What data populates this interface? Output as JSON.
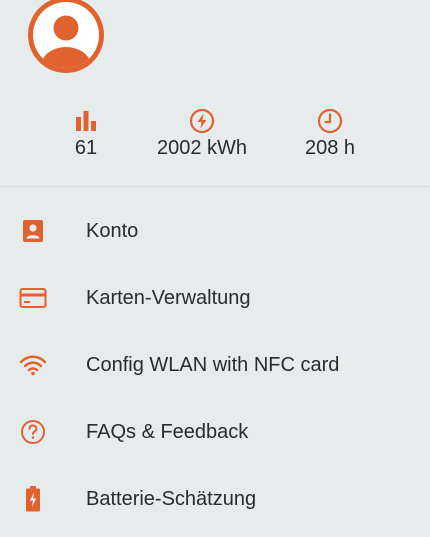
{
  "colors": {
    "accent": "#e0622f",
    "background": "#e6ebec",
    "text": "#2b2b2b"
  },
  "profile": {
    "avatar_icon": "user-circle-icon"
  },
  "stats": [
    {
      "icon": "bar-chart-icon",
      "value": "61"
    },
    {
      "icon": "lightning-icon",
      "value": "2002 kWh"
    },
    {
      "icon": "clock-icon",
      "value": "208 h"
    }
  ],
  "menu": {
    "items": [
      {
        "icon": "account-icon",
        "label": "Konto"
      },
      {
        "icon": "credit-card-icon",
        "label": "Karten-Verwaltung"
      },
      {
        "icon": "wifi-icon",
        "label": "Config WLAN with NFC card"
      },
      {
        "icon": "help-icon",
        "label": "FAQs & Feedback"
      },
      {
        "icon": "battery-icon",
        "label": "Batterie-Schätzung"
      }
    ]
  }
}
